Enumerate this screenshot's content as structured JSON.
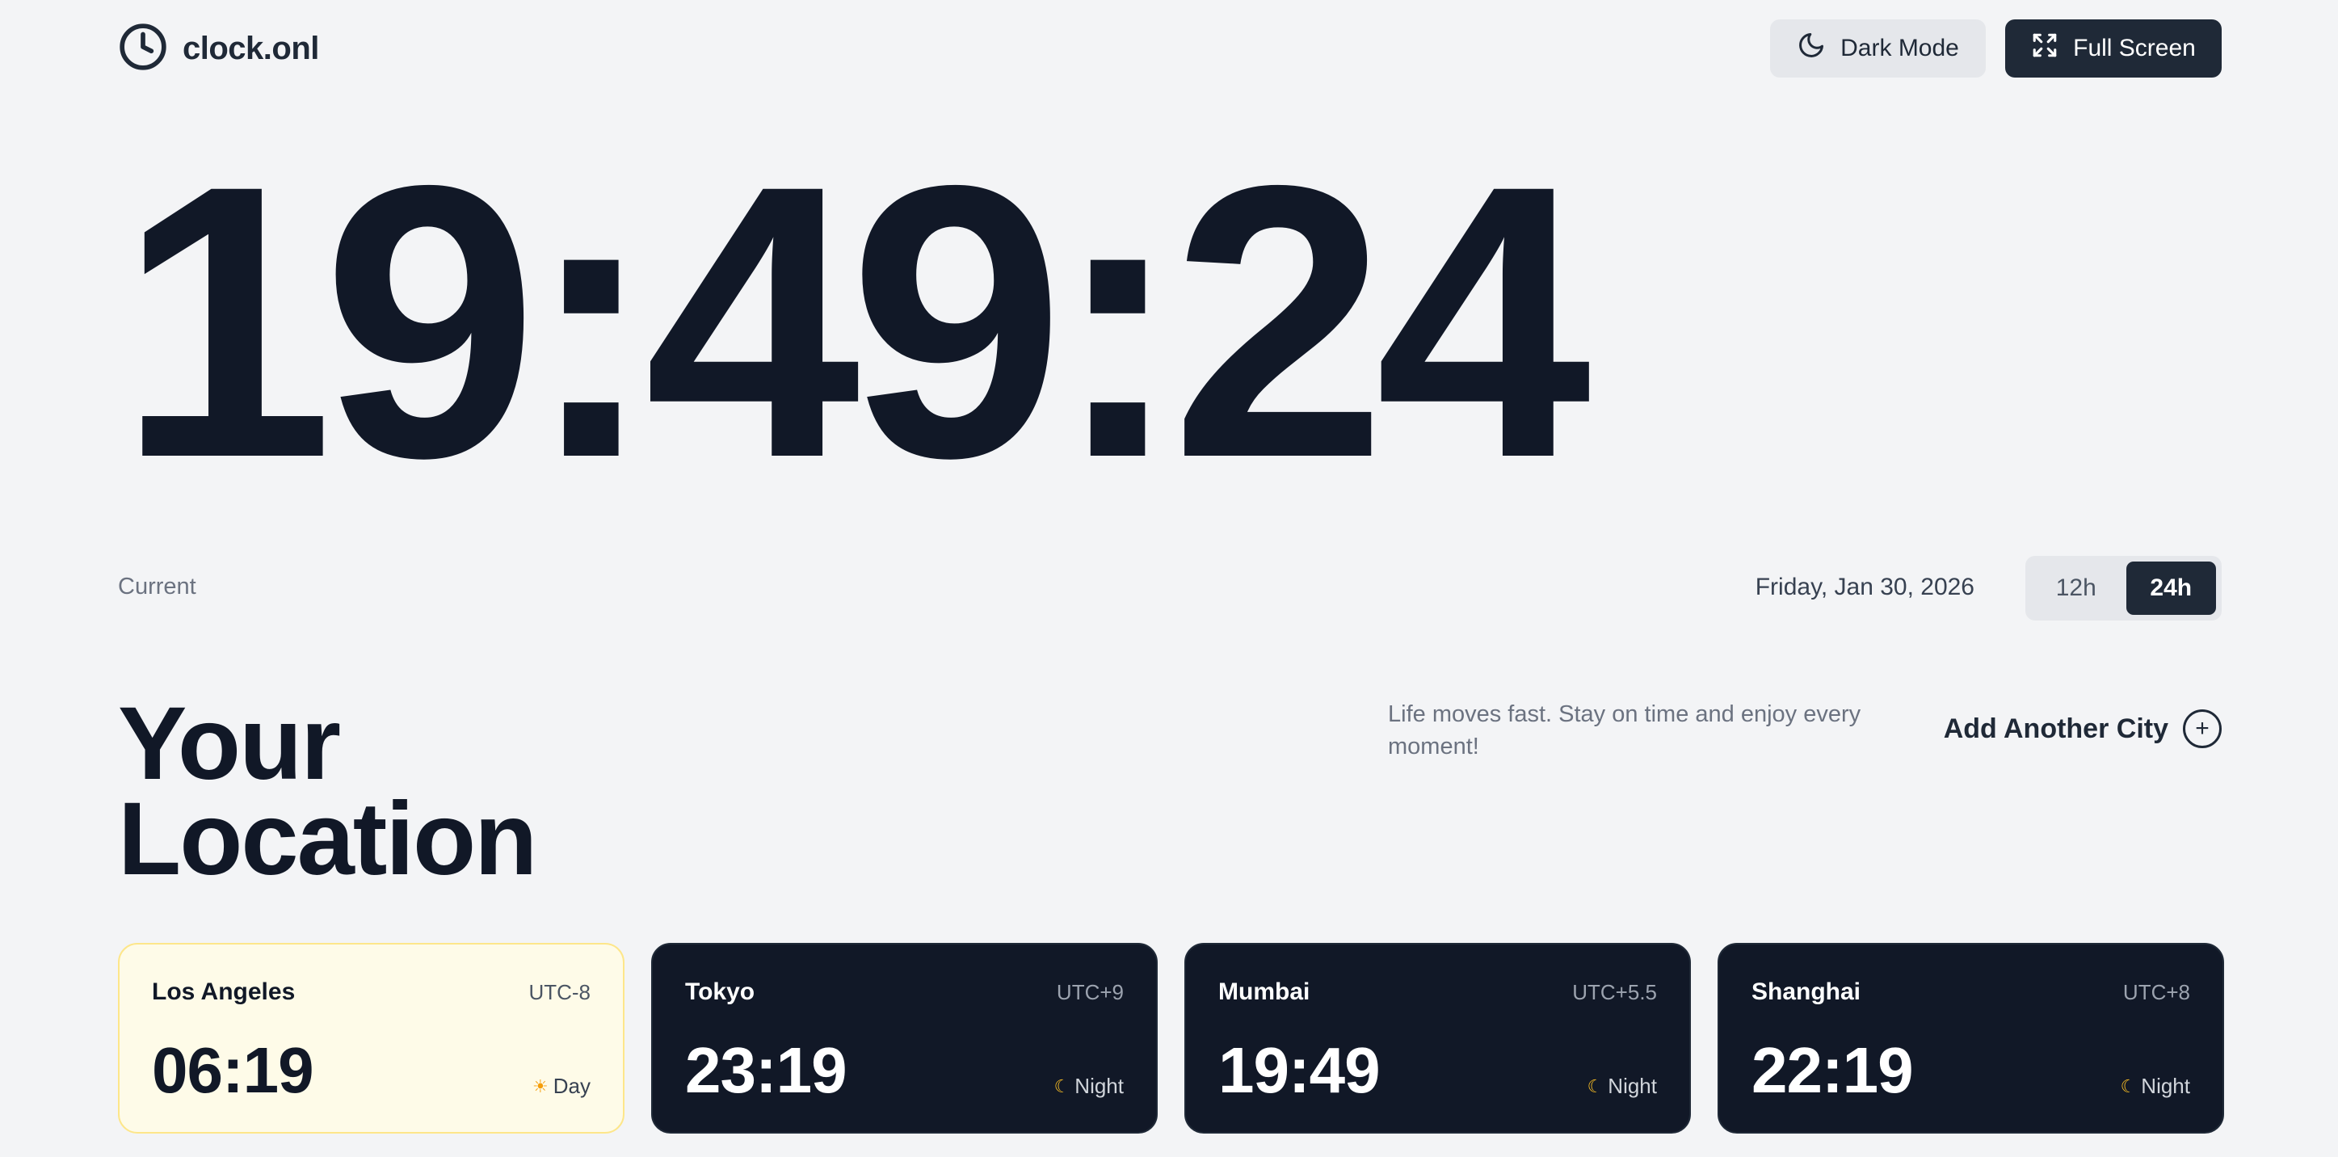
{
  "header": {
    "logo_text": "clock.onl",
    "dark_mode_label": "Dark Mode",
    "fullscreen_label": "Full Screen"
  },
  "clock": {
    "time": "19:49:24",
    "label": "Current",
    "date": "Friday, Jan 30, 2026",
    "format_options": [
      "12h",
      "24h"
    ],
    "selected_format": "24h"
  },
  "location": {
    "title_line1": "Your",
    "title_line2": "Location",
    "tagline": "Life moves fast. Stay on time and enjoy every moment!",
    "add_city_label": "Add Another City",
    "add_city_icon": "+"
  },
  "cities": [
    {
      "name": "Los Angeles",
      "utc": "UTC-8",
      "time": "06:19",
      "phase": "Day",
      "icon": "☀"
    },
    {
      "name": "Tokyo",
      "utc": "UTC+9",
      "time": "23:19",
      "phase": "Night",
      "icon": "☾"
    },
    {
      "name": "Mumbai",
      "utc": "UTC+5.5",
      "time": "19:49",
      "phase": "Night",
      "icon": "☾"
    },
    {
      "name": "Shanghai",
      "utc": "UTC+8",
      "time": "22:19",
      "phase": "Night",
      "icon": "☾"
    }
  ],
  "colors": {
    "background": "#f3f4f6",
    "dark": "#111827",
    "day_card": "#fefbe8",
    "day_card_border": "#fde68a"
  }
}
